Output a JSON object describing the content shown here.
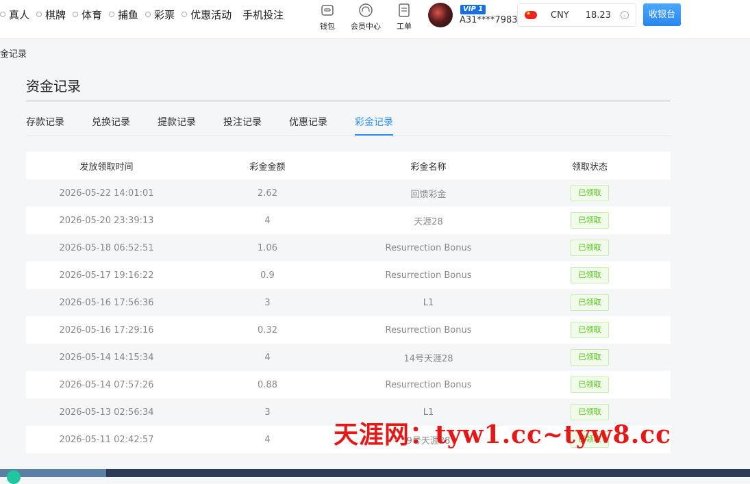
{
  "nav": {
    "items": [
      "真人",
      "棋牌",
      "体育",
      "捕鱼",
      "彩票",
      "优惠活动",
      "手机投注"
    ]
  },
  "tools": [
    {
      "label": "钱包",
      "icon": "wallet-icon"
    },
    {
      "label": "会员中心",
      "icon": "headset-icon"
    },
    {
      "label": "工单",
      "icon": "clipboard-icon"
    }
  ],
  "user": {
    "vip": "VIP 1",
    "id": "A31****7983"
  },
  "currency": {
    "code": "CNY",
    "balance": "18.23",
    "flag_color": "#ee2222"
  },
  "cashier_label": "收银台",
  "breadcrumb": "金记录",
  "page_title": "资金记录",
  "tabs": [
    "存款记录",
    "兑换记录",
    "提款记录",
    "投注记录",
    "优惠记录",
    "彩金记录"
  ],
  "active_tab": 5,
  "table": {
    "headers": [
      "发放领取时间",
      "彩金金额",
      "彩金名称",
      "领取状态"
    ],
    "rows": [
      {
        "time": "2026-05-22 14:01:01",
        "amount": "2.62",
        "name": "回馈彩金",
        "status": "已领取"
      },
      {
        "time": "2026-05-20 23:39:13",
        "amount": "4",
        "name": "天涯28",
        "status": "已领取"
      },
      {
        "time": "2026-05-18 06:52:51",
        "amount": "1.06",
        "name": "Resurrection Bonus",
        "status": "已领取"
      },
      {
        "time": "2026-05-17 19:16:22",
        "amount": "0.9",
        "name": "Resurrection Bonus",
        "status": "已领取"
      },
      {
        "time": "2026-05-16 17:56:36",
        "amount": "3",
        "name": "L1",
        "status": "已领取"
      },
      {
        "time": "2026-05-16 17:29:16",
        "amount": "0.32",
        "name": "Resurrection Bonus",
        "status": "已领取"
      },
      {
        "time": "2026-05-14 14:15:34",
        "amount": "4",
        "name": "14号天涯28",
        "status": "已领取"
      },
      {
        "time": "2026-05-14 07:57:26",
        "amount": "0.88",
        "name": "Resurrection Bonus",
        "status": "已领取"
      },
      {
        "time": "2026-05-13 02:56:34",
        "amount": "3",
        "name": "L1",
        "status": "已领取"
      },
      {
        "time": "2026-05-11 02:42:57",
        "amount": "4",
        "name": "9号天涯28",
        "status": "已领取"
      }
    ]
  },
  "watermark": "天涯网：tyw1.cc~tyw8.cc",
  "colors": {
    "accent": "#2b90f0",
    "status_green": "#52c41a",
    "watermark_red": "#e51818"
  }
}
